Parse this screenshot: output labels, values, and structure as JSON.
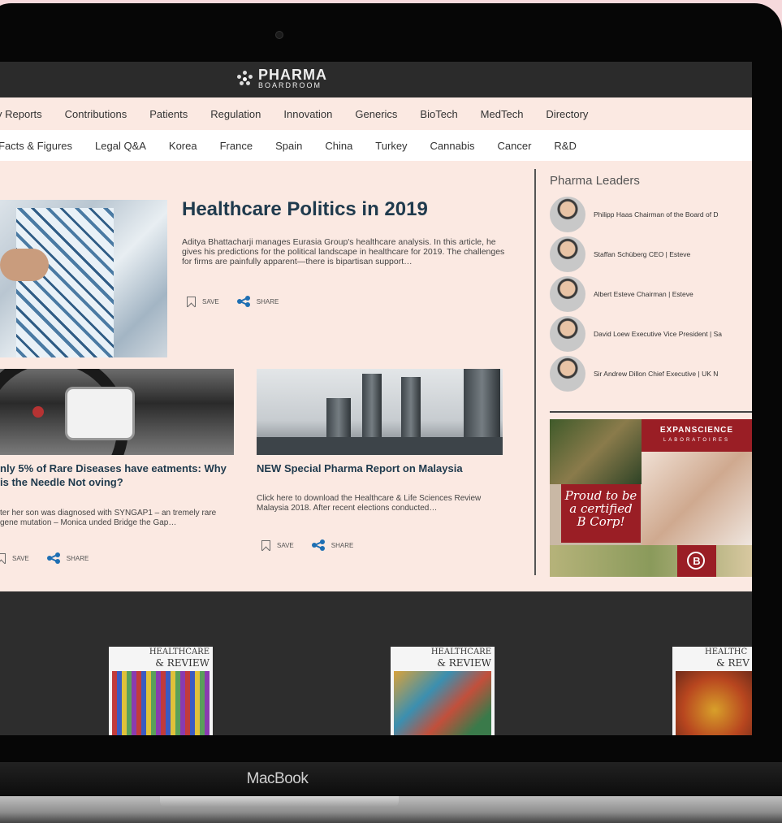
{
  "device": {
    "brand_label": "MacBook"
  },
  "site": {
    "logo_line1": "PHARMA",
    "logo_line2": "BOARDROOM"
  },
  "nav_primary": [
    "y Reports",
    "Contributions",
    "Patients",
    "Regulation",
    "Innovation",
    "Generics",
    "BioTech",
    "MedTech",
    "Directory"
  ],
  "nav_secondary": [
    "Facts & Figures",
    "Legal Q&A",
    "Korea",
    "France",
    "Spain",
    "China",
    "Turkey",
    "Cannabis",
    "Cancer",
    "R&D"
  ],
  "hero": {
    "title": "Healthcare Politics in 2019",
    "excerpt": "Aditya Bhattacharji manages Eurasia Group's healthcare analysis. In this article, he gives his predictions for the political landscape in healthcare for 2019. The challenges for firms are painfully apparent—there is bipartisan support…",
    "save_label": "SAVE",
    "share_label": "SHARE"
  },
  "cards": [
    {
      "title": "nly 5% of Rare Diseases have eatments: Why is the Needle Not oving?",
      "excerpt": "ter her son was diagnosed with SYNGAP1 – an tremely rare gene mutation – Monica unded Bridge the Gap…",
      "save_label": "SAVE",
      "share_label": "SHARE"
    },
    {
      "title": "NEW Special Pharma Report on Malaysia",
      "excerpt": "Click here to download the Healthcare & Life Sciences Review Malaysia 2018. After recent elections conducted…",
      "save_label": "SAVE",
      "share_label": "SHARE"
    }
  ],
  "leaders": {
    "title": "Pharma Leaders",
    "items": [
      "Philipp Haas Chairman of the Board of D",
      "Staffan Schüberg CEO | Esteve",
      "Albert Esteve Chairman | Esteve",
      "David Loew Executive Vice President | Sa",
      "Sir Andrew Dillon Chief Executive | UK N"
    ]
  },
  "ad": {
    "brand": "EXPANSCIENCE",
    "brand_sub": "LABORATOIRES",
    "badge_line1": "Proud to be",
    "badge_line2": "a certified",
    "badge_line3": "B Corp!",
    "bcorp_letter": "B"
  },
  "magazines": [
    {
      "title1": "HEALTHCARE",
      "title2": "& REVIEW"
    },
    {
      "title1": "HEALTHCARE",
      "title2": "& REVIEW"
    },
    {
      "title1": "HEALTHC",
      "title2": "& REV"
    }
  ]
}
